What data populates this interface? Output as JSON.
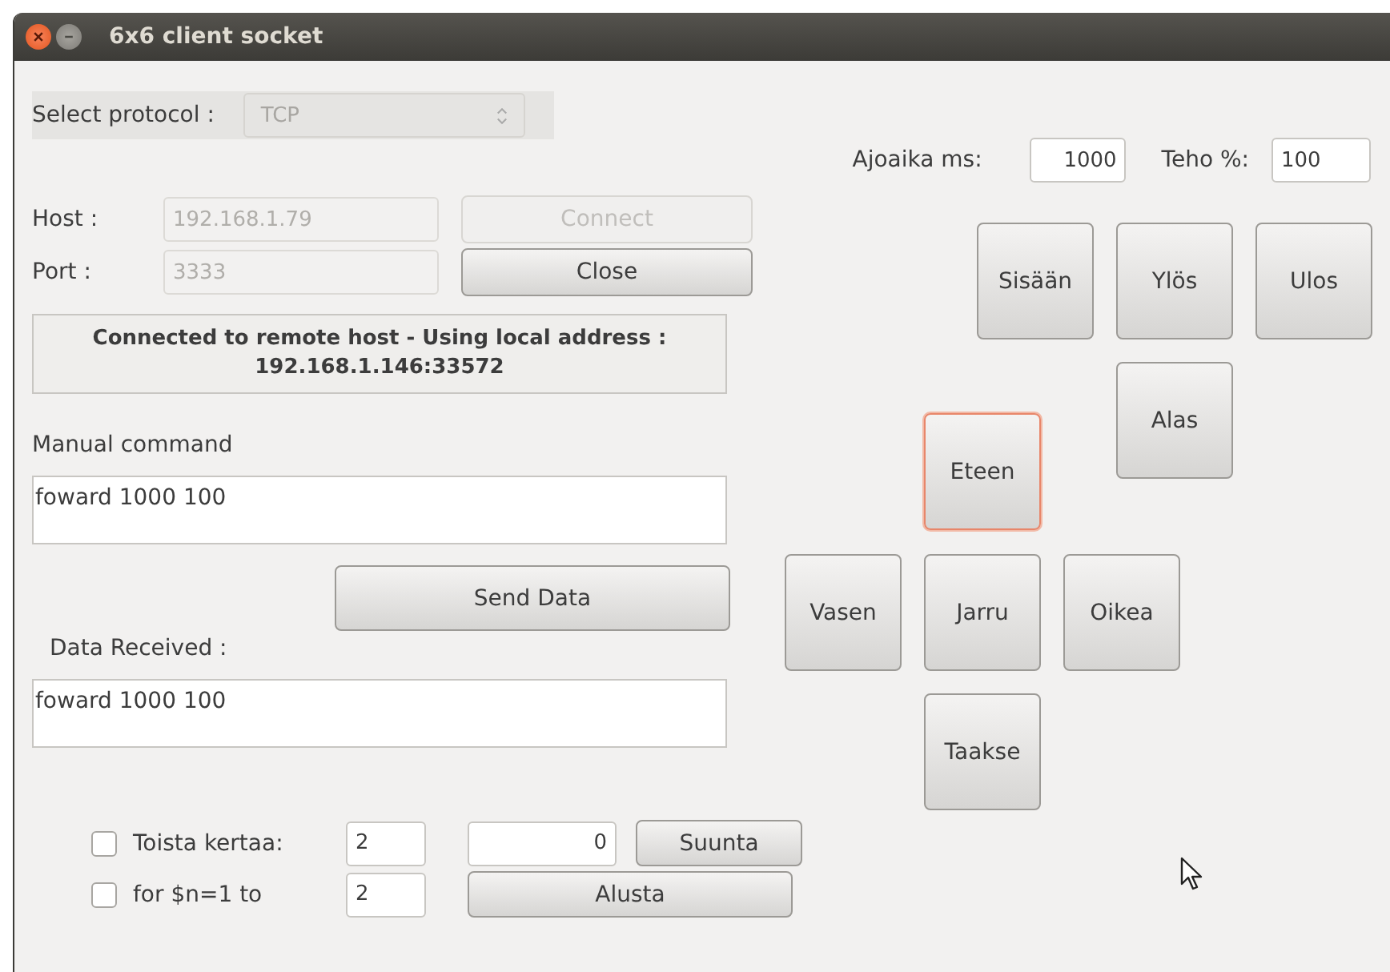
{
  "window": {
    "title": "6x6 client socket"
  },
  "protocol": {
    "label": "Select protocol :",
    "value": "TCP",
    "disabled": true
  },
  "host": {
    "label": "Host :",
    "value": "192.168.1.79",
    "disabled": true
  },
  "port": {
    "label": "Port :",
    "value": "3333",
    "disabled": true
  },
  "connection_buttons": [
    {
      "label": "Connect",
      "disabled": true
    },
    {
      "label": "Close",
      "disabled": false
    }
  ],
  "status": "Connected to remote host - Using local address : 192.168.1.146:33572",
  "manual_command": {
    "label": "Manual command",
    "value": "foward 1000 100"
  },
  "send_button": "Send Data",
  "data_received": {
    "label": "Data Received :",
    "value": "foward 1000 100"
  },
  "repeat_rows": [
    {
      "label": "Toista kertaa:",
      "checked": false,
      "count": "2",
      "value": "0",
      "button": "Suunta"
    },
    {
      "label": "for $n=1 to",
      "checked": false,
      "count": "2",
      "button": "Alusta"
    }
  ],
  "ajoaika": {
    "label": "Ajoaika ms:",
    "value": "1000"
  },
  "teho": {
    "label": "Teho %:",
    "value": "100"
  },
  "pad_buttons": [
    {
      "label": "Sisään",
      "focused": false
    },
    {
      "label": "Ylös",
      "focused": false
    },
    {
      "label": "Ulos",
      "focused": false
    },
    {
      "label": "Alas",
      "focused": false
    },
    {
      "label": "Eteen",
      "focused": true
    },
    {
      "label": "Vasen",
      "focused": false
    },
    {
      "label": "Jarru",
      "focused": false
    },
    {
      "label": "Oikea",
      "focused": false
    },
    {
      "label": "Taakse",
      "focused": false
    }
  ]
}
